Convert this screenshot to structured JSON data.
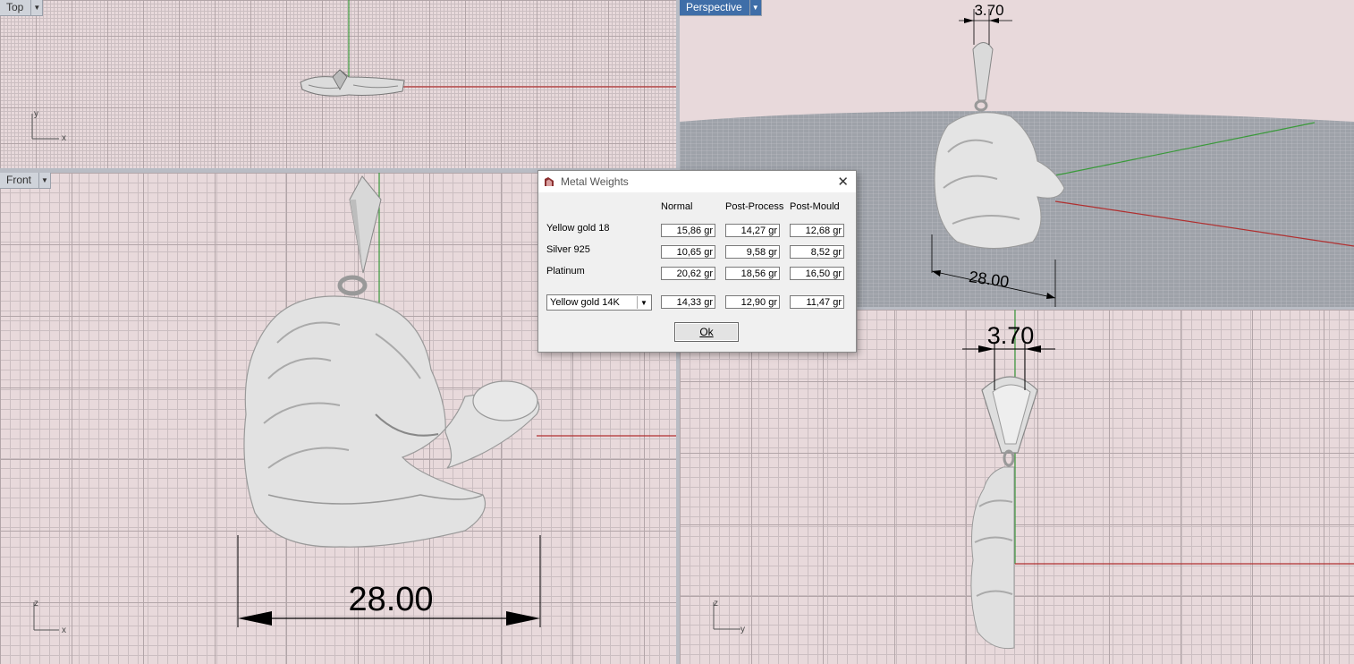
{
  "viewports": {
    "top": {
      "label": "Top",
      "axis_v": "y",
      "axis_h": "x"
    },
    "front": {
      "label": "Front",
      "axis_v": "z",
      "axis_h": "x"
    },
    "perspective": {
      "label": "Perspective"
    },
    "right": {
      "label": "",
      "axis_v": "z",
      "axis_h": "y"
    }
  },
  "dimensions": {
    "width_front": "28.00",
    "width_persp": "28.00",
    "bail_persp": "3.70",
    "bail_right": "3.70"
  },
  "dialog": {
    "title": "Metal Weights",
    "columns": [
      "Normal",
      "Post-Process",
      "Post-Mould"
    ],
    "rows": [
      {
        "metal": "Yellow gold 18",
        "values": [
          "15,86 gr",
          "14,27 gr",
          "12,68 gr"
        ]
      },
      {
        "metal": "Silver 925",
        "values": [
          "10,65 gr",
          "9,58 gr",
          "8,52 gr"
        ]
      },
      {
        "metal": "Platinum",
        "values": [
          "20,62 gr",
          "18,56 gr",
          "16,50 gr"
        ]
      }
    ],
    "custom": {
      "selected": "Yellow gold 14K",
      "values": [
        "14,33 gr",
        "12,90 gr",
        "11,47 gr"
      ]
    },
    "ok_label": "Ok"
  },
  "colors": {
    "axis_x": "#b03030",
    "axis_y": "#3a9a3a",
    "active_tab": "#3f6ea8"
  }
}
